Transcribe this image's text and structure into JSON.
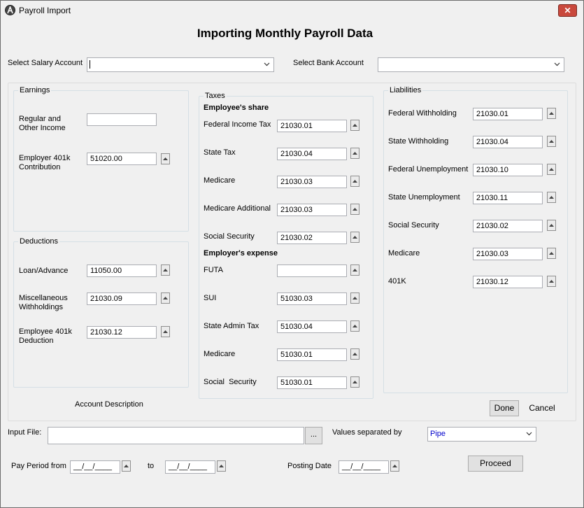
{
  "window": {
    "title": "Payroll Import",
    "close_glyph": "✕"
  },
  "heading": "Importing Monthly Payroll Data",
  "top": {
    "salary_label": "Select Salary Account",
    "salary_value": "",
    "bank_label": "Select Bank Account",
    "bank_value": ""
  },
  "earnings": {
    "title": "Earnings",
    "rows": [
      {
        "label": "Regular and\nOther Income",
        "value": ""
      },
      {
        "label": "Employer 401k\nContribution",
        "value": "51020.00"
      }
    ]
  },
  "deductions": {
    "title": "Deductions",
    "rows": [
      {
        "label": "Loan/Advance",
        "value": "11050.00"
      },
      {
        "label": "Miscellaneous\nWithholdings",
        "value": "21030.09"
      },
      {
        "label": "Employee 401k\nDeduction",
        "value": "21030.12"
      }
    ]
  },
  "account_description": "Account Description",
  "taxes": {
    "title": "Taxes",
    "employee_share_heading": "Employee's share",
    "employee_rows": [
      {
        "label": "Federal Income Tax",
        "value": "21030.01"
      },
      {
        "label": "State Tax",
        "value": "21030.04"
      },
      {
        "label": "Medicare",
        "value": "21030.03"
      },
      {
        "label": "Medicare Additional",
        "value": "21030.03"
      },
      {
        "label": "Social Security",
        "value": "21030.02"
      }
    ],
    "employer_expense_heading": "Employer's expense",
    "employer_rows": [
      {
        "label": "FUTA",
        "value": ""
      },
      {
        "label": "SUI",
        "value": "51030.03"
      },
      {
        "label": "State Admin Tax",
        "value": "51030.04"
      },
      {
        "label": "Medicare",
        "value": "51030.01"
      },
      {
        "label": "Social  Security",
        "value": "51030.01"
      }
    ]
  },
  "liabilities": {
    "title": "Liabilities",
    "rows": [
      {
        "label": "Federal Withholding",
        "value": "21030.01"
      },
      {
        "label": "State Withholding",
        "value": "21030.04"
      },
      {
        "label": "Federal Unemployment",
        "value": "21030.10"
      },
      {
        "label": "State Unemployment",
        "value": "21030.11"
      },
      {
        "label": "Social Security",
        "value": "21030.02"
      },
      {
        "label": "Medicare",
        "value": "21030.03"
      },
      {
        "label": "401K",
        "value": "21030.12"
      }
    ]
  },
  "buttons": {
    "done": "Done",
    "cancel": "Cancel",
    "browse": "...",
    "proceed": "Proceed"
  },
  "input_file": {
    "label": "Input File:",
    "value": ""
  },
  "separator": {
    "label": "Values separated by",
    "value": "Pipe",
    "value_color": "#0000cc"
  },
  "pay_period": {
    "label": "Pay Period from",
    "from_value": "__/__/____",
    "to_label": "to",
    "to_value": "__/__/____"
  },
  "posting_date": {
    "label": "Posting Date",
    "value": "__/__/____"
  },
  "icons": {
    "lookup": "chevron-up-icon",
    "dropdown": "chevron-down-icon",
    "app": "app-logo-icon",
    "close": "close-icon"
  },
  "colors": {
    "close_button": "#c9483c",
    "window_bg": "#f0f0f0"
  }
}
